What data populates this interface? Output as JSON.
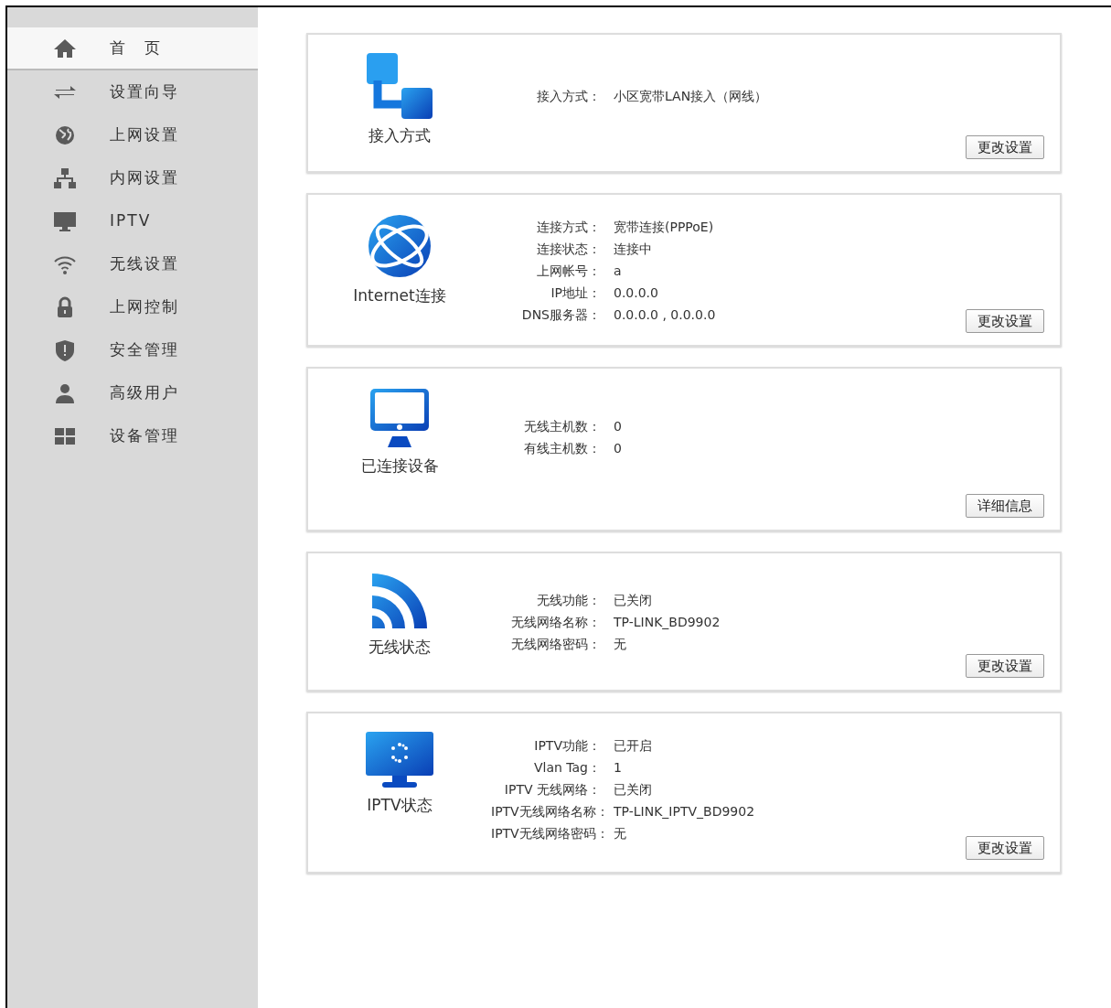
{
  "sidebar": {
    "items": [
      {
        "kind": "home",
        "label": "首　页",
        "selected": true
      },
      {
        "kind": "arrows",
        "label": "设置向导",
        "selected": false
      },
      {
        "kind": "globe",
        "label": "上网设置",
        "selected": false
      },
      {
        "kind": "network",
        "label": "内网设置",
        "selected": false
      },
      {
        "kind": "monitor",
        "label": "IPTV",
        "selected": false
      },
      {
        "kind": "wifi",
        "label": "无线设置",
        "selected": false
      },
      {
        "kind": "lock",
        "label": "上网控制",
        "selected": false
      },
      {
        "kind": "shield",
        "label": "安全管理",
        "selected": false
      },
      {
        "kind": "user",
        "label": "高级用户",
        "selected": false
      },
      {
        "kind": "grid",
        "label": "设备管理",
        "selected": false
      }
    ]
  },
  "cards": [
    {
      "kind": "access",
      "title": "接入方式",
      "fields": [
        {
          "label": "接入方式：",
          "value": "小区宽带LAN接入（网线）"
        }
      ],
      "button": "更改设置"
    },
    {
      "kind": "globe",
      "title": "Internet连接",
      "fields": [
        {
          "label": "连接方式：",
          "value": "宽带连接(PPPoE)"
        },
        {
          "label": "连接状态：",
          "value": "连接中"
        },
        {
          "label": "上网帐号：",
          "value": "a"
        },
        {
          "label": "IP地址：",
          "value": "0.0.0.0"
        },
        {
          "label": "DNS服务器：",
          "value": "0.0.0.0 , 0.0.0.0"
        }
      ],
      "button": "更改设置"
    },
    {
      "kind": "monitor",
      "title": "已连接设备",
      "fields": [
        {
          "label": "无线主机数：",
          "value": "0"
        },
        {
          "label": "有线主机数：",
          "value": "0"
        }
      ],
      "button": "详细信息"
    },
    {
      "kind": "wifi",
      "title": "无线状态",
      "fields": [
        {
          "label": "无线功能：",
          "value": "已关闭"
        },
        {
          "label": "无线网络名称：",
          "value": "TP-LINK_BD9902"
        },
        {
          "label": "无线网络密码：",
          "value": "无"
        }
      ],
      "button": "更改设置"
    },
    {
      "kind": "tv",
      "title": "IPTV状态",
      "fields": [
        {
          "label": "IPTV功能：",
          "value": "已开启"
        },
        {
          "label": "Vlan Tag：",
          "value": "1"
        },
        {
          "label": "IPTV 无线网络：",
          "value": "已关闭"
        },
        {
          "label": "IPTV无线网络名称：",
          "value": "TP-LINK_IPTV_BD9902"
        },
        {
          "label": "IPTV无线网络密码：",
          "value": "无"
        }
      ],
      "button": "更改设置"
    }
  ]
}
